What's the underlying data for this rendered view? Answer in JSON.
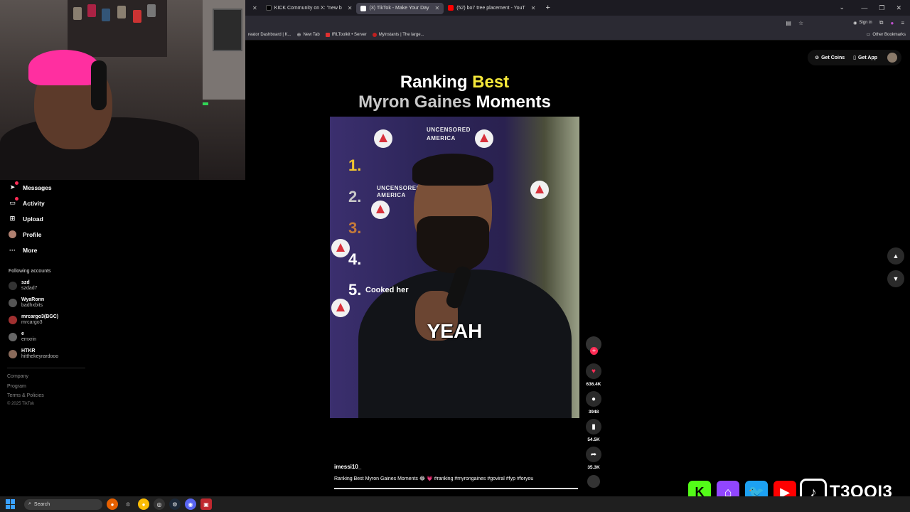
{
  "browser": {
    "tabs": [
      {
        "label": "KICK Community on X: \"new b",
        "icon_color": "#000000"
      },
      {
        "label": "(3) TikTok - Make Your Day",
        "icon_color": "#ffffff",
        "active": true
      },
      {
        "label": "(52) bo7 tree placement - YouT",
        "icon_color": "#ff0000"
      }
    ],
    "new_tab_glyph": "+",
    "sign_in": "Sign in",
    "bookmarks": [
      {
        "label": "reator Dashboard | K...",
        "color": "#53fc18"
      },
      {
        "label": "New Tab",
        "color": "#cccccc"
      },
      {
        "label": "IRLToolkit • Server",
        "color": "#e03030"
      },
      {
        "label": "Myinstants | The large...",
        "color": "#c02020"
      }
    ],
    "other_bookmarks": "Other Bookmarks"
  },
  "sidebar": {
    "menu": [
      {
        "label": "Messages",
        "icon": "send-icon",
        "glyph": "➤",
        "badge": true
      },
      {
        "label": "Activity",
        "icon": "inbox-icon",
        "glyph": "▭",
        "badge": true
      },
      {
        "label": "Upload",
        "icon": "upload-icon",
        "glyph": "⊞"
      },
      {
        "label": "Profile",
        "icon": "avatar"
      },
      {
        "label": "More",
        "icon": "more-icon",
        "glyph": "···"
      }
    ],
    "following_header": "Following accounts",
    "accounts": [
      {
        "name": "szd",
        "handle": "szdad7",
        "color": "#333333"
      },
      {
        "name": "WyaRonn",
        "handle": "badhxbits",
        "color": "#555555"
      },
      {
        "name": "mrcargo3(BGC)",
        "handle": "mrcargo3",
        "color": "#a03030"
      },
      {
        "name": "e",
        "handle": "emxrin",
        "color": "#666666"
      },
      {
        "name": "HTKR",
        "handle": "hitthekeyrardooo",
        "color": "#8a6a5a"
      }
    ],
    "footer": [
      "Company",
      "Program",
      "Terms & Policies"
    ],
    "copyright": "© 2025 TikTok"
  },
  "topright": {
    "get_coins": "Get Coins",
    "get_app": "Get App"
  },
  "video": {
    "title_line1_a": "Ranking ",
    "title_line1_b": "Best",
    "title_line2_a": "Myron Gaines",
    "title_line2_b": " Moments",
    "ranks": [
      {
        "num": "1.",
        "color": "#f0c430"
      },
      {
        "num": "2.",
        "color": "#c8c8c8"
      },
      {
        "num": "3.",
        "color": "#c47a3a"
      },
      {
        "num": "4.",
        "color": "#ffffff"
      },
      {
        "num": "5.",
        "color": "#ffffff"
      }
    ],
    "rank5_label": "Cooked her",
    "caption": "YEAH",
    "backdrop_text": [
      "UNCENSORED",
      "AMERICA"
    ],
    "username": "imessi10_",
    "description": "Ranking Best Myron Gaines Moments 😂 💗 #ranking #myrongaines #goviral #fyp #foryou",
    "progress": 1.0
  },
  "actions": {
    "likes": "636.4K",
    "comments": "3948",
    "saves": "54.5K",
    "shares": "35.3K",
    "like_color": "#fe2c55"
  },
  "overlay": {
    "handle": "T3OQI3",
    "socials": [
      {
        "name": "kick",
        "glyph": "K",
        "bg": "#53fc18",
        "fg": "#000000"
      },
      {
        "name": "twitch",
        "glyph": "⌂",
        "bg": "#9146ff",
        "fg": "#ffffff"
      },
      {
        "name": "twitter",
        "glyph": "🐦",
        "bg": "#1da1f2",
        "fg": "#ffffff"
      },
      {
        "name": "youtube",
        "glyph": "▶",
        "bg": "#ff0000",
        "fg": "#ffffff"
      },
      {
        "name": "tiktok",
        "glyph": "♪",
        "bg": "#000000",
        "fg": "#ffffff"
      }
    ]
  },
  "taskbar": {
    "search_placeholder": "Search"
  }
}
